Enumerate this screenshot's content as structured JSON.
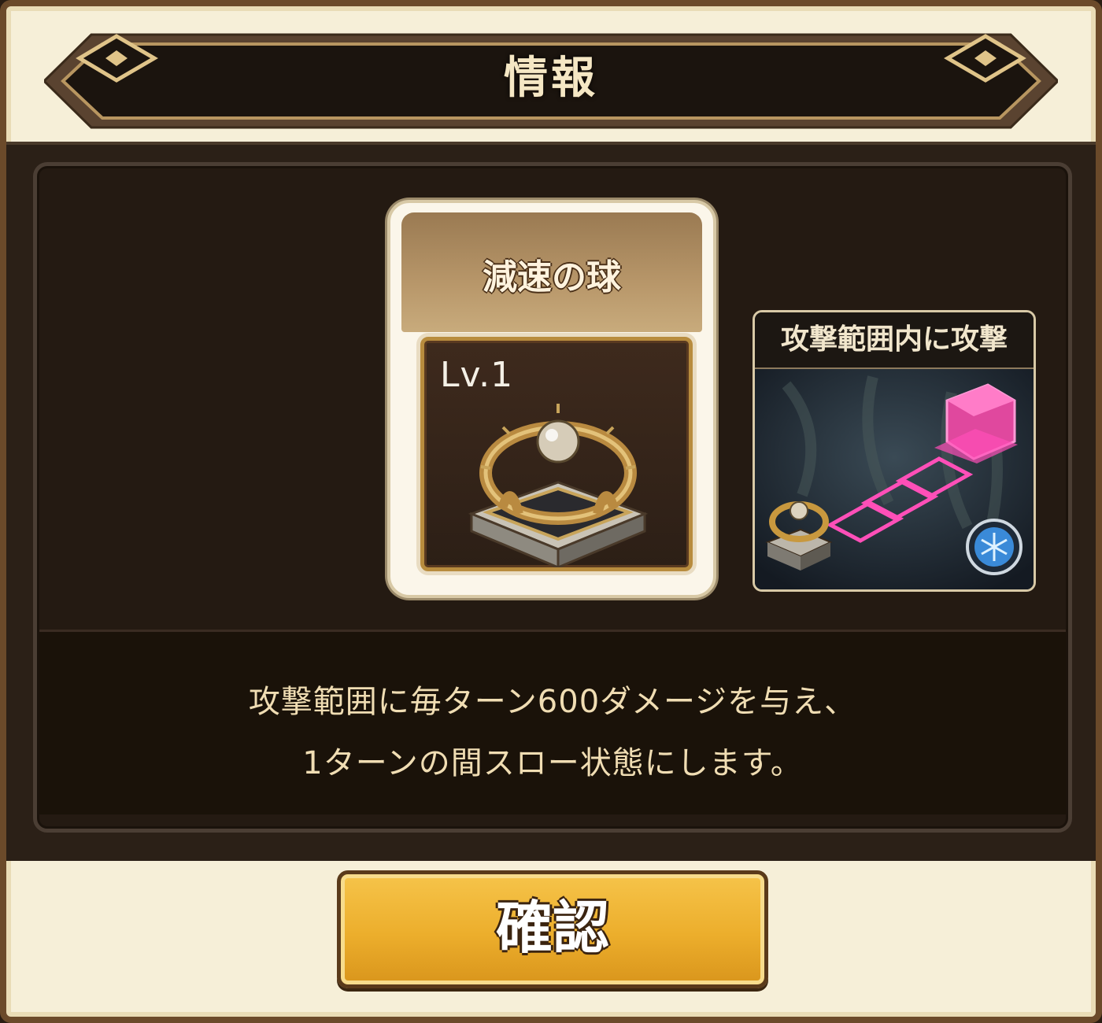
{
  "dialog": {
    "title": "情報"
  },
  "item": {
    "name": "減速の球",
    "level": "Lv.1",
    "icon": "orb-tower-icon"
  },
  "preview": {
    "title": "攻撃範囲内に攻撃",
    "icon": "snowflake-icon"
  },
  "description": {
    "line1": "攻撃範囲に毎ターン600ダメージを与え、",
    "line2": "1ターンの間スロー状態にします。"
  },
  "confirm": {
    "label": "確認"
  },
  "colors": {
    "frame": "#6b4a2a",
    "panel": "#241a12",
    "accent_gold": "#ecae2c",
    "text_cream": "#f0ddb3",
    "attack_range": "#ff4fb8"
  }
}
